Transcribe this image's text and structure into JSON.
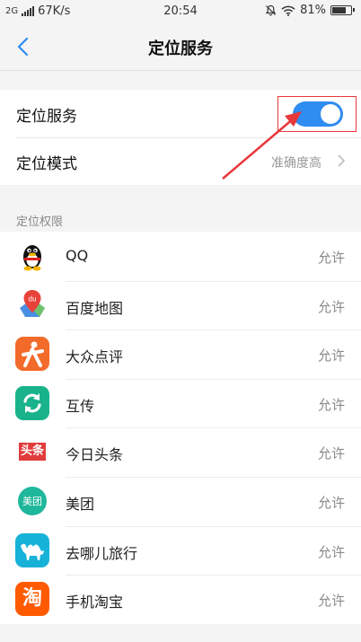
{
  "status_bar": {
    "network": "2G",
    "speed": "67K/s",
    "time": "20:54",
    "battery": "81%",
    "battery_level": 0.81,
    "icons": [
      "signal-icon",
      "mute-bell-icon",
      "wifi-icon",
      "battery-icon"
    ]
  },
  "nav": {
    "title": "定位服务",
    "back_icon": "back-chevron-icon"
  },
  "settings": {
    "location_service_label": "定位服务",
    "location_service_enabled": true,
    "location_mode_label": "定位模式",
    "location_mode_value": "准确度高"
  },
  "permissions": {
    "header": "定位权限",
    "apps": [
      {
        "name": "QQ",
        "permission": "允许",
        "icon": "qq-penguin-icon"
      },
      {
        "name": "百度地图",
        "permission": "允许",
        "icon": "baidu-map-icon"
      },
      {
        "name": "大众点评",
        "permission": "允许",
        "icon": "dianping-icon",
        "icon_label": "大"
      },
      {
        "name": "互传",
        "permission": "允许",
        "icon": "transfer-icon"
      },
      {
        "name": "今日头条",
        "permission": "允许",
        "icon": "toutiao-icon",
        "icon_label": "头条"
      },
      {
        "name": "美团",
        "permission": "允许",
        "icon": "meituan-icon",
        "icon_label": "美团"
      },
      {
        "name": "去哪儿旅行",
        "permission": "允许",
        "icon": "qunar-camel-icon"
      },
      {
        "name": "手机淘宝",
        "permission": "允许",
        "icon": "taobao-icon",
        "icon_label": "淘"
      }
    ]
  },
  "colors": {
    "accent": "#2f8cf0",
    "annotation": "#e8373a",
    "dianping": "#f26b2a",
    "transfer": "#19b38b",
    "toutiao": "#e23b3b",
    "meituan": "#1fb79b",
    "qunar": "#16b2d8",
    "taobao": "#ff5a00"
  }
}
